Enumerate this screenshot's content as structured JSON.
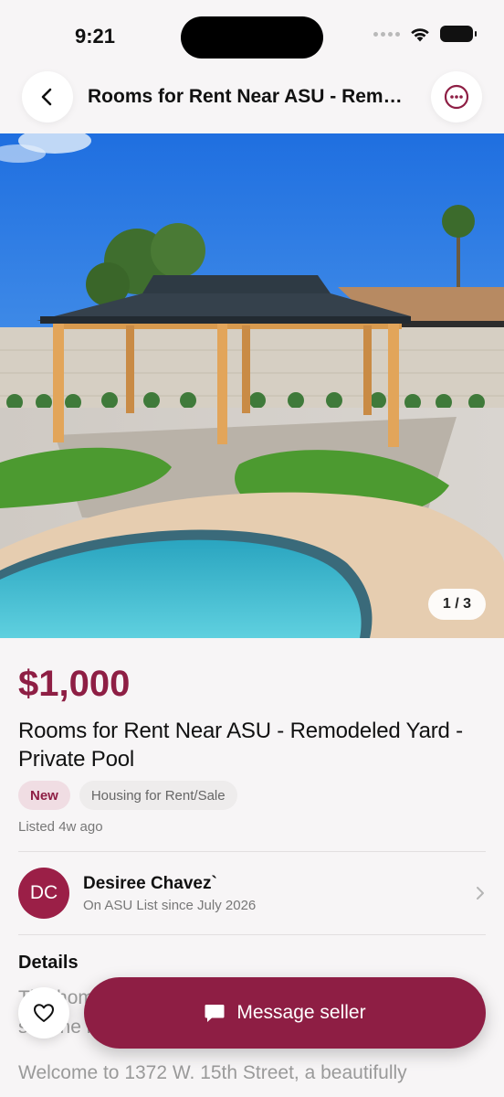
{
  "status_bar": {
    "time": "9:21"
  },
  "nav": {
    "title": "Rooms for Rent Near ASU - Remodeled Yard - Private Pool"
  },
  "gallery": {
    "current": "1 / 3"
  },
  "listing": {
    "price": "$1,000",
    "title": "Rooms for Rent Near ASU - Remodeled Yard - Private Pool",
    "badge_new": "New",
    "category": "Housing for Rent/Sale",
    "listed": "Listed 4w ago"
  },
  "seller": {
    "initials": "DC",
    "name": "Desiree Chavez`",
    "since": "On ASU List since July 2026"
  },
  "details": {
    "heading": "Details",
    "paragraph_1": "The home is available for rent to ASU students. Please see the lease terms and room pricing below.",
    "paragraph_2": "Welcome to 1372 W. 15th Street, a beautifully"
  },
  "actions": {
    "message_label": "Message seller"
  },
  "colors": {
    "accent": "#8e1e44",
    "badge_bg": "#f0dde3",
    "background": "#f7f5f6"
  },
  "icons": [
    "back-arrow-icon",
    "more-options-icon",
    "chevron-right-icon",
    "heart-icon",
    "chat-bubble-icon",
    "wifi-icon",
    "battery-icon"
  ]
}
